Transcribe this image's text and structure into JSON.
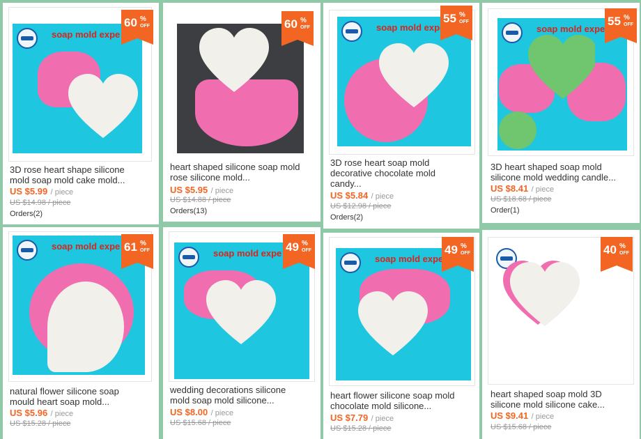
{
  "brand_text": "soap mold expe",
  "off_label": "OFF",
  "percent_sign": "%",
  "colors": {
    "accent": "#f26522",
    "brand_red": "#d8261c",
    "image_bg": "#1ec6e0",
    "page_bg": "#8fc9a8",
    "mold_pink": "#f06eb0",
    "mold_white": "#f2f0ea",
    "mold_green": "#6fc66f"
  },
  "products": [
    {
      "discount": "60",
      "title_line1": "3D rose heart shape silicone",
      "title_line2": "mold soap mold cake mold...",
      "price": "US $5.99",
      "unit": "/ piece",
      "original": "US $14.98 / piece",
      "orders": "Orders(2)"
    },
    {
      "discount": "60",
      "title_line1": "heart shaped silicone soap mold",
      "title_line2": "rose silicone mold...",
      "price": "US $5.95",
      "unit": "/ piece",
      "original": "US $14.88 / piece",
      "orders": "Orders(13)"
    },
    {
      "discount": "55",
      "title_line1": "3D rose heart soap mold",
      "title_line2": "decorative chocolate mold",
      "title_line3": "candy...",
      "price": "US $5.84",
      "unit": "/ piece",
      "original": "US $12.98 / piece",
      "orders": "Orders(2)"
    },
    {
      "discount": "55",
      "title_line1": "3D heart shaped soap mold",
      "title_line2": "silicone mold wedding candle...",
      "price": "US $8.41",
      "unit": "/ piece",
      "original": "US $18.68 / piece",
      "orders": "Order(1)"
    },
    {
      "discount": "61",
      "title_line1": "natural flower silicone soap",
      "title_line2": "mould heart soap mold...",
      "price": "US $5.96",
      "unit": "/ piece",
      "original": "US $15.28 / piece"
    },
    {
      "discount": "49",
      "title_line1": "wedding decorations silicone",
      "title_line2": "mold soap mold silicone...",
      "price": "US $8.00",
      "unit": "/ piece",
      "original": "US $15.68 / piece"
    },
    {
      "discount": "49",
      "title_line1": "heart flower silicone soap mold",
      "title_line2": "chocolate mold silicone...",
      "price": "US $7.79",
      "unit": "/ piece",
      "original": "US $15.28 / piece"
    },
    {
      "discount": "40",
      "title_line1": "heart shaped soap mold 3D",
      "title_line2": "silicone mold silicone cake...",
      "price": "US $9.41",
      "unit": "/ piece",
      "original": "US $15.68 / piece"
    }
  ]
}
